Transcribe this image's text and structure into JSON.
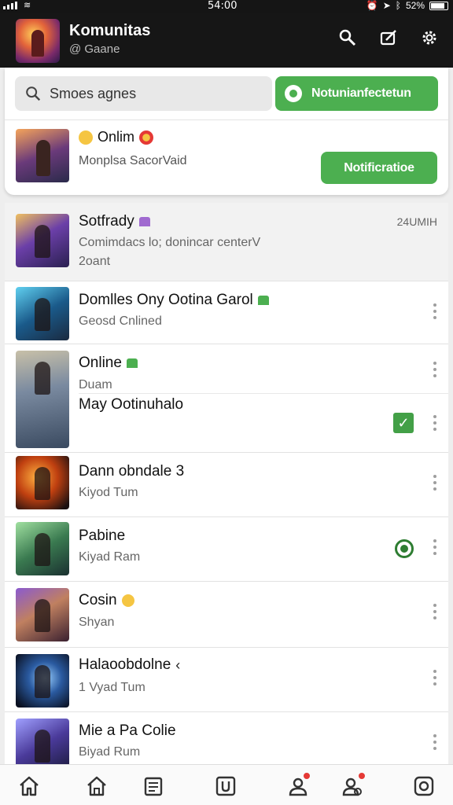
{
  "status_bar": {
    "time": "54:00",
    "battery": "52%"
  },
  "app": {
    "title": "Komunitas",
    "subtitle": "@ Gaane"
  },
  "search": {
    "placeholder": "Smoes agnes"
  },
  "top_card": {
    "notification_button": "Notunianfectetun",
    "online_label": "Onlim",
    "online_sub": "Monplsa SacorVaid",
    "notification_button_2": "Notificratioe"
  },
  "list": [
    {
      "name": "Sotfrady",
      "sub1": "Comimdacs lo; donincar centerV",
      "sub2": "2oant",
      "time": "24UMIH",
      "tag": "purple"
    },
    {
      "name": "Domlles Ony Ootina Garol",
      "sub1": "Geosd Cnlined",
      "tag": "green"
    },
    {
      "name": "Online",
      "sub1": "Duam",
      "tag": "green"
    },
    {
      "name": "May Ootinuhalo",
      "checked": true
    },
    {
      "name": "Dann obndale 3",
      "sub1": "Kiyod Tum"
    },
    {
      "name": "Pabine",
      "sub1": "Kiyad Ram",
      "whatsapp": true
    },
    {
      "name": "Cosin",
      "sub1": "Shyan",
      "tag": "yellow"
    },
    {
      "name": "Halaoobdolne",
      "sub1": "1 Vyad Tum",
      "tag": "arrow"
    },
    {
      "name": "Mie a Pa Colie",
      "sub1": "Biyad Rum"
    }
  ],
  "bottom_nav": [
    "home-icon",
    "home-outline-icon",
    "news-icon",
    "u-icon",
    "alert-person-icon",
    "friends-icon",
    "settings-icon"
  ],
  "colors": {
    "accent_green": "#4caf50",
    "appbar": "#161616",
    "badge_red": "#e53935"
  }
}
